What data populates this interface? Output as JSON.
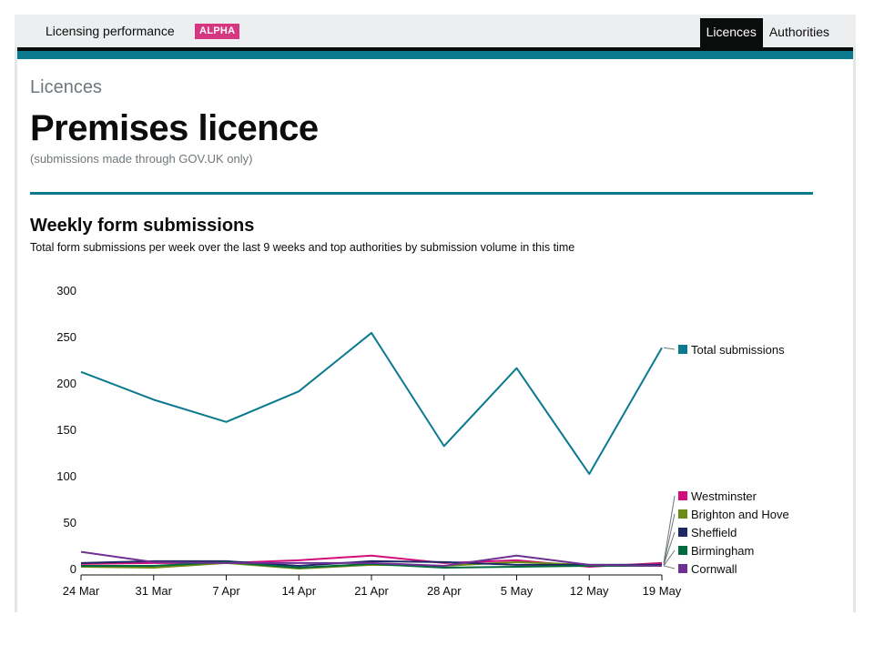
{
  "header": {
    "service_name": "Licensing performance",
    "phase_tag": "ALPHA",
    "nav": [
      {
        "label": "Licences",
        "active": true
      },
      {
        "label": "Authorities",
        "active": false
      }
    ]
  },
  "page": {
    "caption": "Licences",
    "title": "Premises licence",
    "subtitle": "(submissions made through GOV.UK only)"
  },
  "section": {
    "heading": "Weekly form submissions",
    "description": "Total form submissions per week over the last 9 weeks and top authorities by submission volume in this time"
  },
  "colors": {
    "brand_teal": "#0b7a8e",
    "alpha_tag": "#d53880"
  },
  "chart_data": {
    "type": "line",
    "categories": [
      "24 Mar",
      "31 Mar",
      "7 Apr",
      "14 Apr",
      "21 Apr",
      "28 Apr",
      "5 May",
      "12 May",
      "19 May"
    ],
    "ylim": [
      0,
      300
    ],
    "yticks": [
      "0",
      "50",
      "100",
      "150",
      "200",
      "250",
      "300"
    ],
    "legend_placement": "right (end of lines)",
    "grid": false,
    "series": [
      {
        "name": "Total submissions",
        "color": "#0b7a8e",
        "values": [
          212,
          182,
          158,
          191,
          254,
          132,
          216,
          102,
          238
        ]
      },
      {
        "name": "Westminster",
        "color": "#d10f7c",
        "values": [
          5,
          6,
          6,
          9,
          14,
          6,
          9,
          2,
          6
        ]
      },
      {
        "name": "Brighton and Hove",
        "color": "#6d8a14",
        "values": [
          2,
          1,
          6,
          0,
          4,
          3,
          7,
          4,
          4
        ]
      },
      {
        "name": "Sheffield",
        "color": "#1d2865",
        "values": [
          6,
          8,
          8,
          3,
          8,
          7,
          4,
          4,
          4
        ]
      },
      {
        "name": "Birmingham",
        "color": "#006b3c",
        "values": [
          3,
          3,
          7,
          1,
          5,
          1,
          2,
          3,
          3
        ]
      },
      {
        "name": "Cornwall",
        "color": "#6f3094",
        "values": [
          18,
          7,
          6,
          6,
          6,
          3,
          14,
          4,
          3
        ]
      }
    ]
  }
}
